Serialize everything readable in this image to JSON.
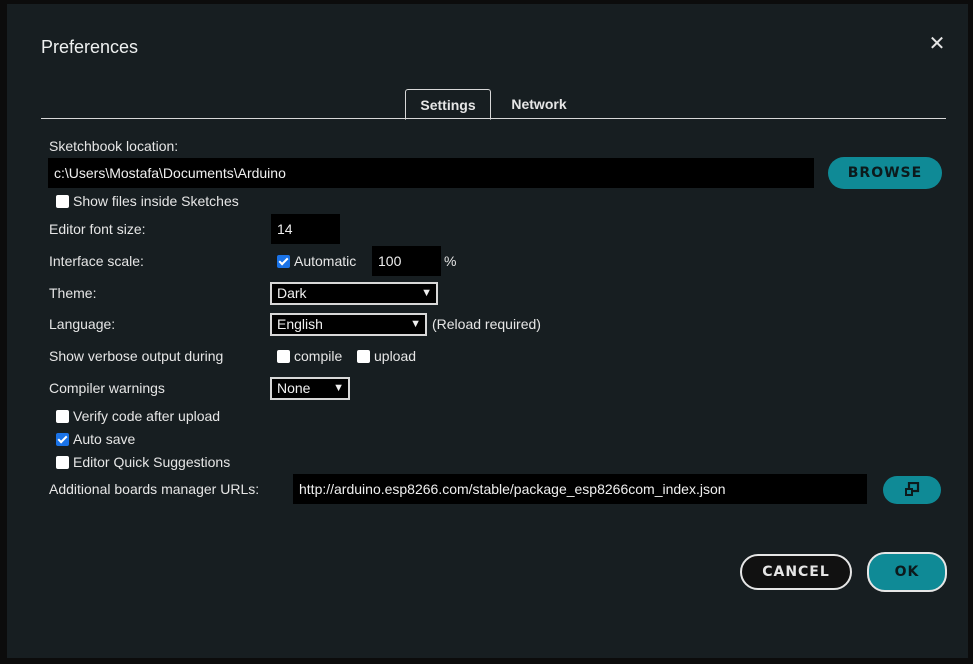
{
  "dialog": {
    "title": "Preferences"
  },
  "tabs": [
    {
      "label": "Settings"
    },
    {
      "label": "Network"
    }
  ],
  "sketchbook": {
    "label": "Sketchbook location:",
    "value": "c:\\Users\\Mostafa\\Documents\\Arduino",
    "browse_label": "BROWSE",
    "show_files_label": "Show files inside Sketches",
    "show_files_checked": false
  },
  "editor_font": {
    "label": "Editor font size:",
    "value": "14"
  },
  "interface_scale": {
    "label": "Interface scale:",
    "automatic_label": "Automatic",
    "automatic_checked": true,
    "value": "100",
    "unit": "%"
  },
  "theme": {
    "label": "Theme:",
    "selected": "Dark"
  },
  "language": {
    "label": "Language:",
    "selected": "English",
    "note": "(Reload required)"
  },
  "verbose": {
    "label": "Show verbose output during",
    "compile_label": "compile",
    "compile_checked": false,
    "upload_label": "upload",
    "upload_checked": false
  },
  "compiler_warnings": {
    "label": "Compiler warnings",
    "selected": "None"
  },
  "options": [
    {
      "label": "Verify code after upload",
      "checked": false
    },
    {
      "label": "Auto save",
      "checked": true
    },
    {
      "label": "Editor Quick Suggestions",
      "checked": false
    }
  ],
  "boards_urls": {
    "label": "Additional boards manager URLs:",
    "value": "http://arduino.esp8266.com/stable/package_esp8266com_index.json",
    "open_icon": "external-window-icon"
  },
  "footer": {
    "cancel_label": "CANCEL",
    "ok_label": "OK"
  },
  "colors": {
    "accent": "#0f8a96",
    "background": "#171e21",
    "checkbox_checked": "#1a73e8"
  }
}
